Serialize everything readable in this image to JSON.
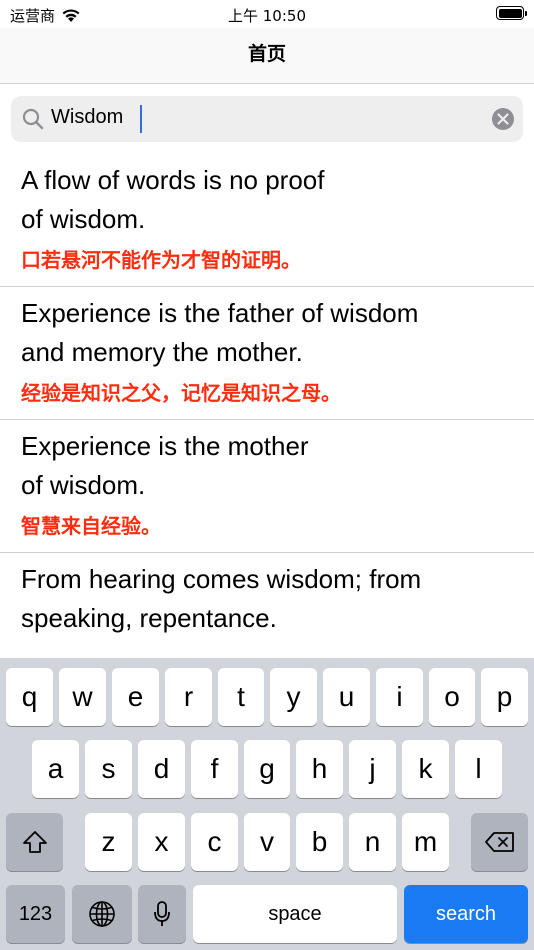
{
  "status": {
    "carrier": "运营商",
    "time": "上午 10:50",
    "battery_level": 1.0
  },
  "nav": {
    "title": "首页"
  },
  "search": {
    "value": "Wisdom"
  },
  "results": [
    {
      "en": "A flow of words is no proof\nof wisdom.",
      "zh": "口若悬河不能作为才智的证明。"
    },
    {
      "en": "Experience is the father of wisdom\nand memory the mother.",
      "zh": "经验是知识之父，记忆是知识之母。"
    },
    {
      "en": "Experience is the mother\nof wisdom.",
      "zh": "智慧来自经验。"
    },
    {
      "en": "From hearing comes wisdom; from\nspeaking, repentance.",
      "zh": ""
    }
  ],
  "keyboard": {
    "row1": [
      "q",
      "w",
      "e",
      "r",
      "t",
      "y",
      "u",
      "i",
      "o",
      "p"
    ],
    "row2": [
      "a",
      "s",
      "d",
      "f",
      "g",
      "h",
      "j",
      "k",
      "l"
    ],
    "row3": [
      "z",
      "x",
      "c",
      "v",
      "b",
      "n",
      "m"
    ],
    "numbers_label": "123",
    "space_label": "space",
    "search_label": "search"
  },
  "colors": {
    "accent": "#1a7cf5",
    "translation": "#ff2d10",
    "keyboard_bg": "#d1d4da"
  }
}
